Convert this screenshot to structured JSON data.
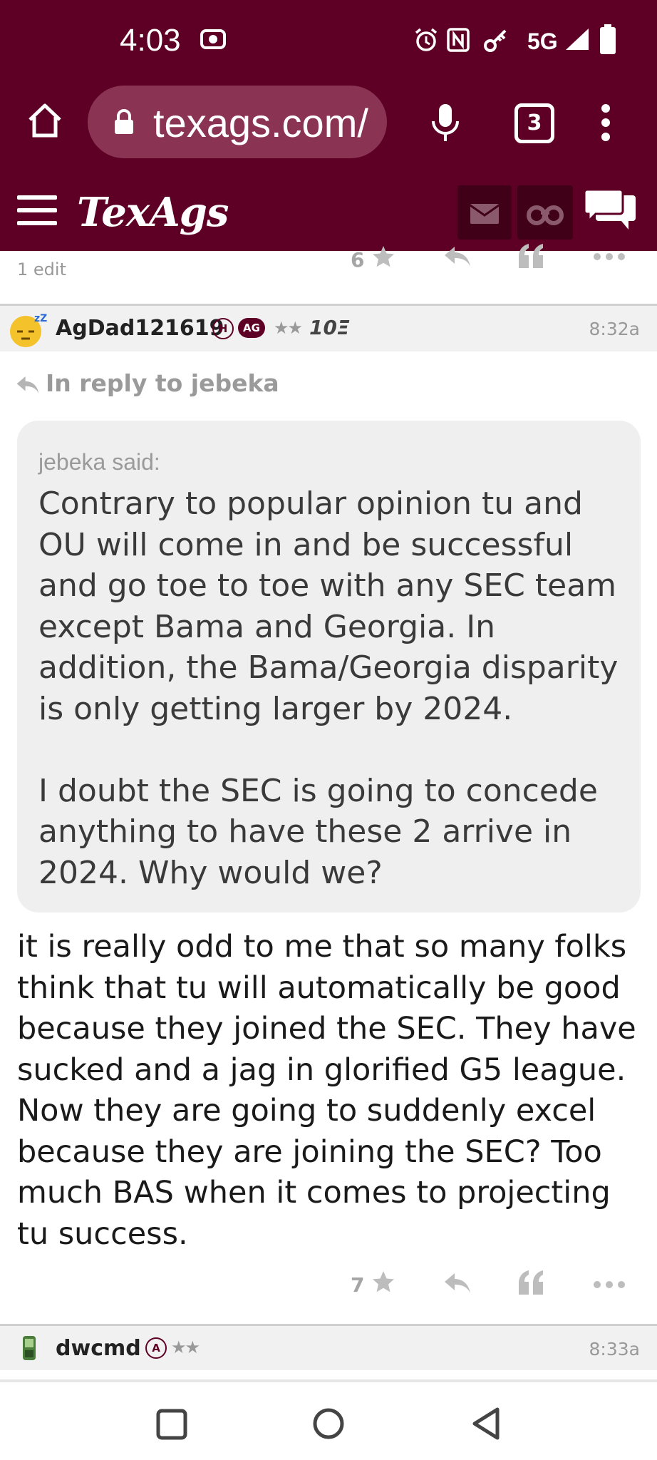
{
  "status_bar": {
    "time": "4:03",
    "network": "5G"
  },
  "browser": {
    "url": "texags.com/",
    "tab_count": "3"
  },
  "site": {
    "logo": "TexAgs"
  },
  "prev_post": {
    "edit_note": "1 edit",
    "star_count": "6"
  },
  "post": {
    "username": "AgDad121619",
    "badge_h": "H",
    "badge_ag": "AG",
    "rank_stars": "★★",
    "xp": "10Ξ",
    "time": "8:32a",
    "reply_to": "In reply to jebeka",
    "quote_author": "jebeka said:",
    "quote_text": "Contrary to popular opinion tu and OU will come in and be successful and go toe to toe with any SEC team except Bama and Georgia. In addition, the Bama/Georgia disparity is only getting larger by 2024.\n\nI doubt the SEC is going to concede anything to have these 2 arrive in 2024. Why would we?",
    "body": "it is really odd to me that so many folks think that tu will automatically be good because they joined the SEC. They have sucked and a jag in glorified G5 league. Now they are going to suddenly excel because they are joining the SEC? Too much BAS when it comes to projecting tu success.",
    "star_count": "7"
  },
  "next_post": {
    "username": "dwcmd",
    "badge": "A",
    "rank_stars": "★★",
    "time": "8:33a"
  },
  "colors": {
    "maroon": "#5e0025",
    "pill": "#8a3352",
    "dark_btn": "#3f0018"
  }
}
